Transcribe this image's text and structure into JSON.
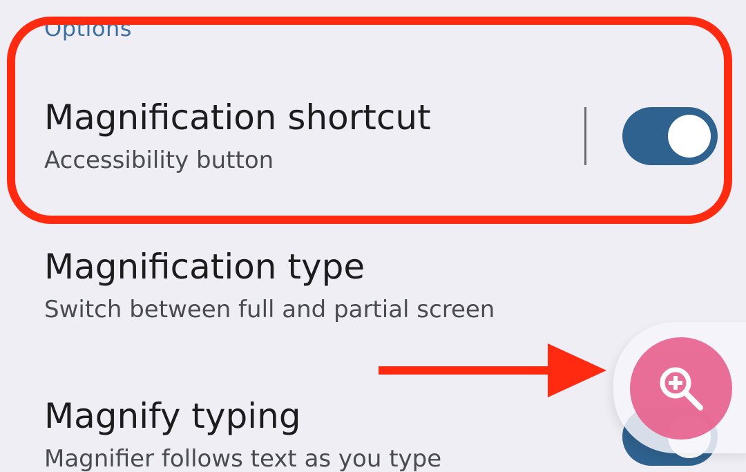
{
  "section": {
    "header": "Options"
  },
  "settings": [
    {
      "title": "Magnification shortcut",
      "subtitle": "Accessibility button",
      "toggle_on": true
    },
    {
      "title": "Magnification type",
      "subtitle": "Switch between full and partial screen"
    },
    {
      "title": "Magnify typing",
      "subtitle": "Magnifier follows text as you type",
      "toggle_on": true
    }
  ],
  "colors": {
    "background": "#eeeef4",
    "accent": "#2f628e",
    "annotation": "#ff2a10",
    "fab": "#e8638f"
  },
  "icons": {
    "fab": "zoom-in-icon",
    "annotation_arrow": "arrow-right-icon"
  }
}
